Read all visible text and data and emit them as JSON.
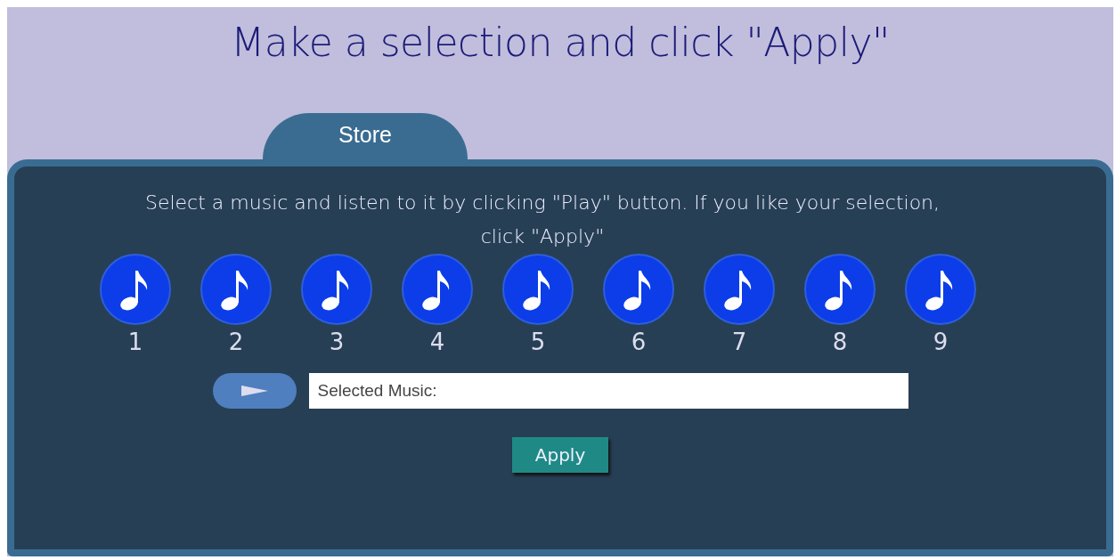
{
  "title": "Make a selection and click \"Apply\"",
  "tab": {
    "label": "Store"
  },
  "instruction": "Select a music and listen to it by clicking \"Play\" button. If you  like your selection, click \"Apply\"",
  "tracks": [
    {
      "label": "1"
    },
    {
      "label": "2"
    },
    {
      "label": "3"
    },
    {
      "label": "4"
    },
    {
      "label": "5"
    },
    {
      "label": "6"
    },
    {
      "label": "7"
    },
    {
      "label": "8"
    },
    {
      "label": "9"
    }
  ],
  "selected_field": {
    "value": "Selected Music:"
  },
  "apply_button": {
    "label": "Apply"
  }
}
